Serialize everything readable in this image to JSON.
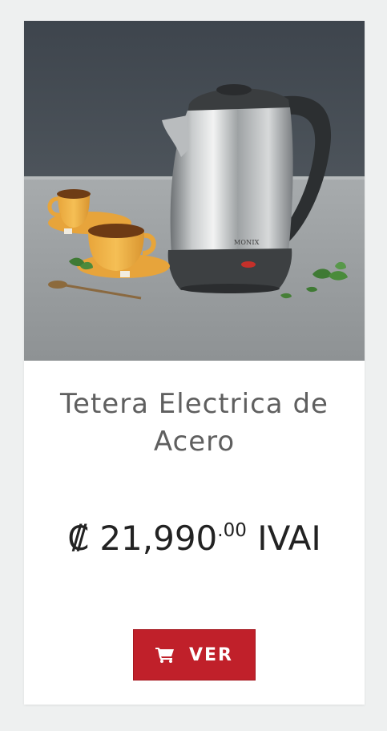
{
  "product": {
    "image_alt": "Tetera eléctrica de acero inoxidable con tazas de té",
    "brand_on_kettle": "MONIX",
    "title": "Tetera Electrica de Acero",
    "price": {
      "currency_symbol": "₡",
      "whole": "21,990",
      "cents": ".00",
      "suffix": "IVAI"
    },
    "button": {
      "icon": "shopping-cart-icon",
      "label": "VER"
    }
  },
  "colors": {
    "button_background": "#c0202a",
    "title_text": "#5f5f5f",
    "price_text": "#222222",
    "page_background": "#eef0f0"
  }
}
